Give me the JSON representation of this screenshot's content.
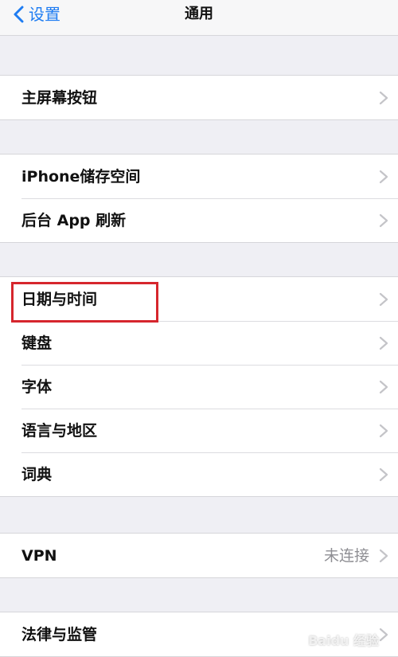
{
  "nav": {
    "back_label": "设置",
    "title": "通用"
  },
  "groups": [
    {
      "rows": [
        {
          "label": "主屏幕按钮",
          "value": ""
        }
      ]
    },
    {
      "rows": [
        {
          "label": "iPhone储存空间",
          "value": ""
        },
        {
          "label": "后台 App 刷新",
          "value": ""
        }
      ]
    },
    {
      "rows": [
        {
          "label": "日期与时间",
          "value": ""
        },
        {
          "label": "键盘",
          "value": ""
        },
        {
          "label": "字体",
          "value": ""
        },
        {
          "label": "语言与地区",
          "value": ""
        },
        {
          "label": "词典",
          "value": ""
        }
      ]
    },
    {
      "rows": [
        {
          "label": "VPN",
          "value": "未连接"
        }
      ]
    },
    {
      "rows": [
        {
          "label": "法律与监管",
          "value": ""
        }
      ]
    }
  ],
  "watermark": "Baidu 经验",
  "colors": {
    "accent": "#1e7cf2",
    "highlight": "#d6262d",
    "background": "#efeff4"
  }
}
